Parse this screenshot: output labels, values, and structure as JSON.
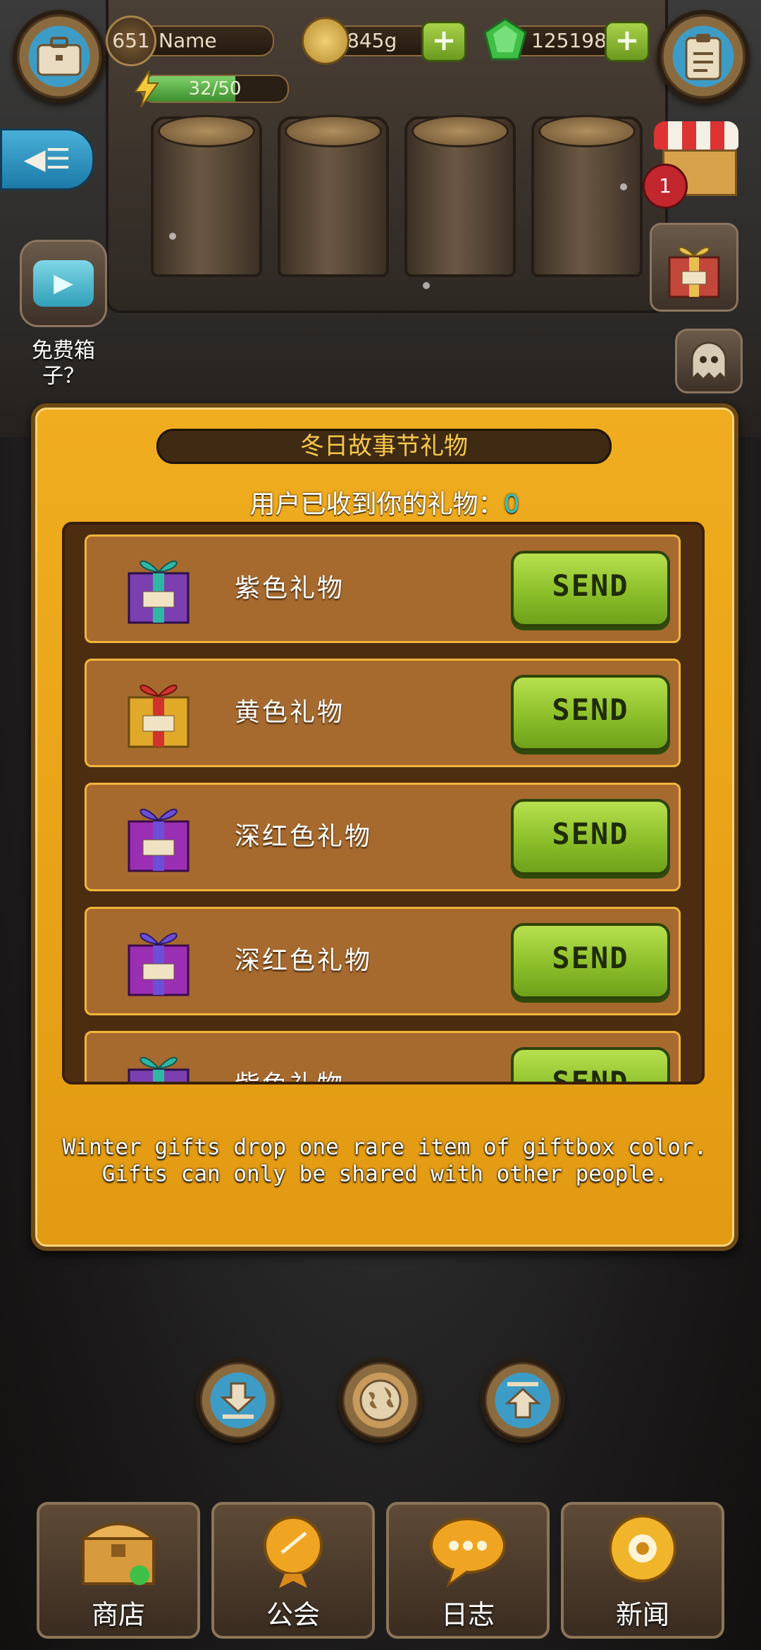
{
  "hud": {
    "level": "651",
    "player_name": "Name",
    "gold": "845g",
    "gems": "125198",
    "energy": "32/50",
    "energy_fraction": 0.64
  },
  "side": {
    "free_box_label": "免费箱子？",
    "shop_badge_count": "1"
  },
  "panel": {
    "title": "冬日故事节礼物",
    "received_prefix": "用户已收到你的礼物：",
    "received_count": "0",
    "gifts": [
      {
        "label": "紫色礼物",
        "send": "SEND",
        "color": "teal-purple"
      },
      {
        "label": "黄色礼物",
        "send": "SEND",
        "color": "red-yellow"
      },
      {
        "label": "深红色礼物",
        "send": "SEND",
        "color": "purple"
      },
      {
        "label": "深红色礼物",
        "send": "SEND",
        "color": "purple"
      },
      {
        "label": "紫色礼物",
        "send": "SEND",
        "color": "teal-purple"
      }
    ],
    "note_line1": "Winter gifts drop one rare item of giftbox color.",
    "note_line2": "Gifts can only be shared with other people."
  },
  "nav": {
    "shop": "商店",
    "guild": "公会",
    "log": "日志",
    "news": "新闻"
  },
  "icons": [
    "briefcase-icon",
    "clipboard-icon",
    "back-menu-icon",
    "tv-play-icon",
    "ghost-icon",
    "download-icon",
    "globe-icon",
    "upload-icon",
    "coin-icon",
    "gem-icon",
    "lightning-icon"
  ],
  "colors": {
    "panel": "#e8a317",
    "send_button": "#9ccd36",
    "count_accent": "#2bc6c8",
    "title_text": "#f6c84a"
  }
}
